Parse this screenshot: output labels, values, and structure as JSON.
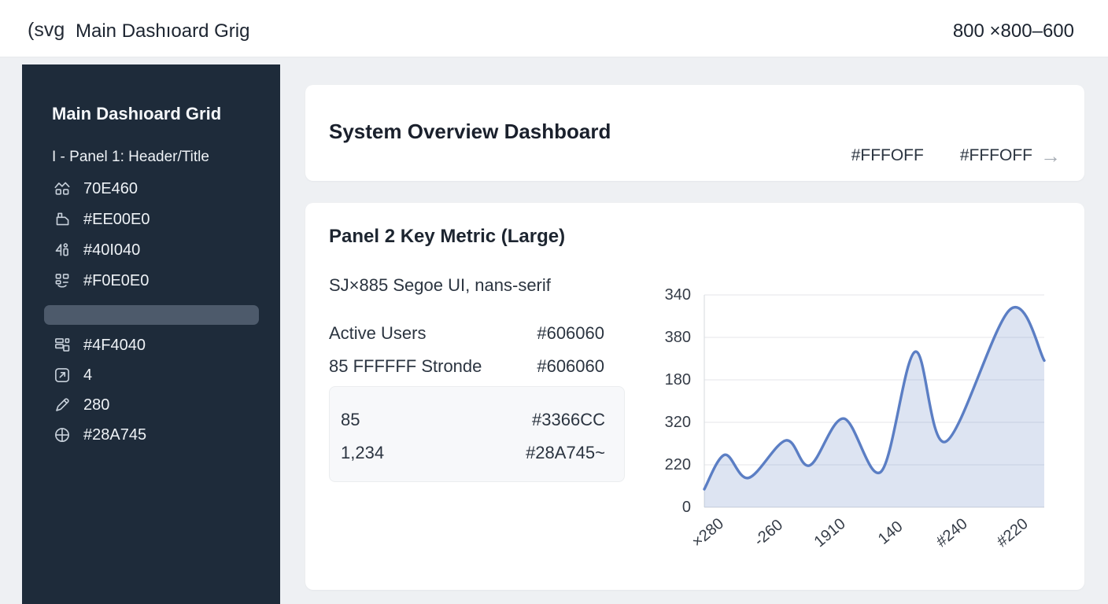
{
  "header": {
    "logo": "(svg",
    "title": "Main Dashıoard Grig",
    "dimensions": "800 ×800–600"
  },
  "sidebar": {
    "title": "Main Dashıoard Grid",
    "section_label": "I - Panel 1: Header/Title",
    "items_top": [
      {
        "icon": "home-group-icon",
        "label": "70E460"
      },
      {
        "icon": "container-icon",
        "label": "#EE00E0"
      },
      {
        "icon": "shape-tool-icon",
        "label": "#40I040"
      },
      {
        "icon": "grid-dots-icon",
        "label": "#F0E0E0"
      }
    ],
    "items_bottom": [
      {
        "icon": "layout-grid-icon",
        "label": "#4F4040"
      },
      {
        "icon": "external-link-icon",
        "label": "4"
      },
      {
        "icon": "pencil-icon",
        "label": "280"
      },
      {
        "icon": "globe-icon",
        "label": "#28A745"
      }
    ]
  },
  "overview_card": {
    "title": "System Overview Dashboard",
    "value_a": "#FFFOFF",
    "value_b": "#FFFOFF",
    "arrow": "→"
  },
  "metric_card": {
    "title": "Panel 2 Key Metric (Large)",
    "subtitle": "SJ×885 Segoe UI, nans-serif",
    "rows": [
      {
        "label": "Active Users",
        "value": "#606060"
      },
      {
        "label": "85 FFFFFF Stronde",
        "value": "#606060"
      }
    ],
    "stat_box": [
      {
        "label": "85",
        "value": "#3366CC"
      },
      {
        "label": "1,234",
        "value": "#28A745~"
      }
    ]
  },
  "chart_data": {
    "type": "area",
    "title": "",
    "y_ticks": [
      "340",
      "380",
      "180",
      "320",
      "220",
      "0"
    ],
    "categories": [
      "×280",
      "-260",
      "1910",
      "140",
      "#240",
      "#220"
    ],
    "x_frac": [
      0,
      0.06,
      0.13,
      0.24,
      0.31,
      0.41,
      0.52,
      0.62,
      0.71,
      0.9,
      1
    ],
    "values": [
      29,
      84,
      47,
      107,
      67,
      142,
      57,
      249,
      105,
      317,
      235
    ],
    "ylim": [
      0,
      340
    ],
    "grid": true,
    "legend": false,
    "line_color": "#5b7ec4",
    "fill_color": "rgba(98,134,198,0.22)"
  },
  "theme": {
    "sidebar_bg": "#1e2b3a",
    "selected_bg": "#4d5a6b",
    "page_bg": "#eef0f3",
    "card_bg": "#ffffff",
    "accent_blue": "#3366CC",
    "accent_green": "#28A745"
  }
}
